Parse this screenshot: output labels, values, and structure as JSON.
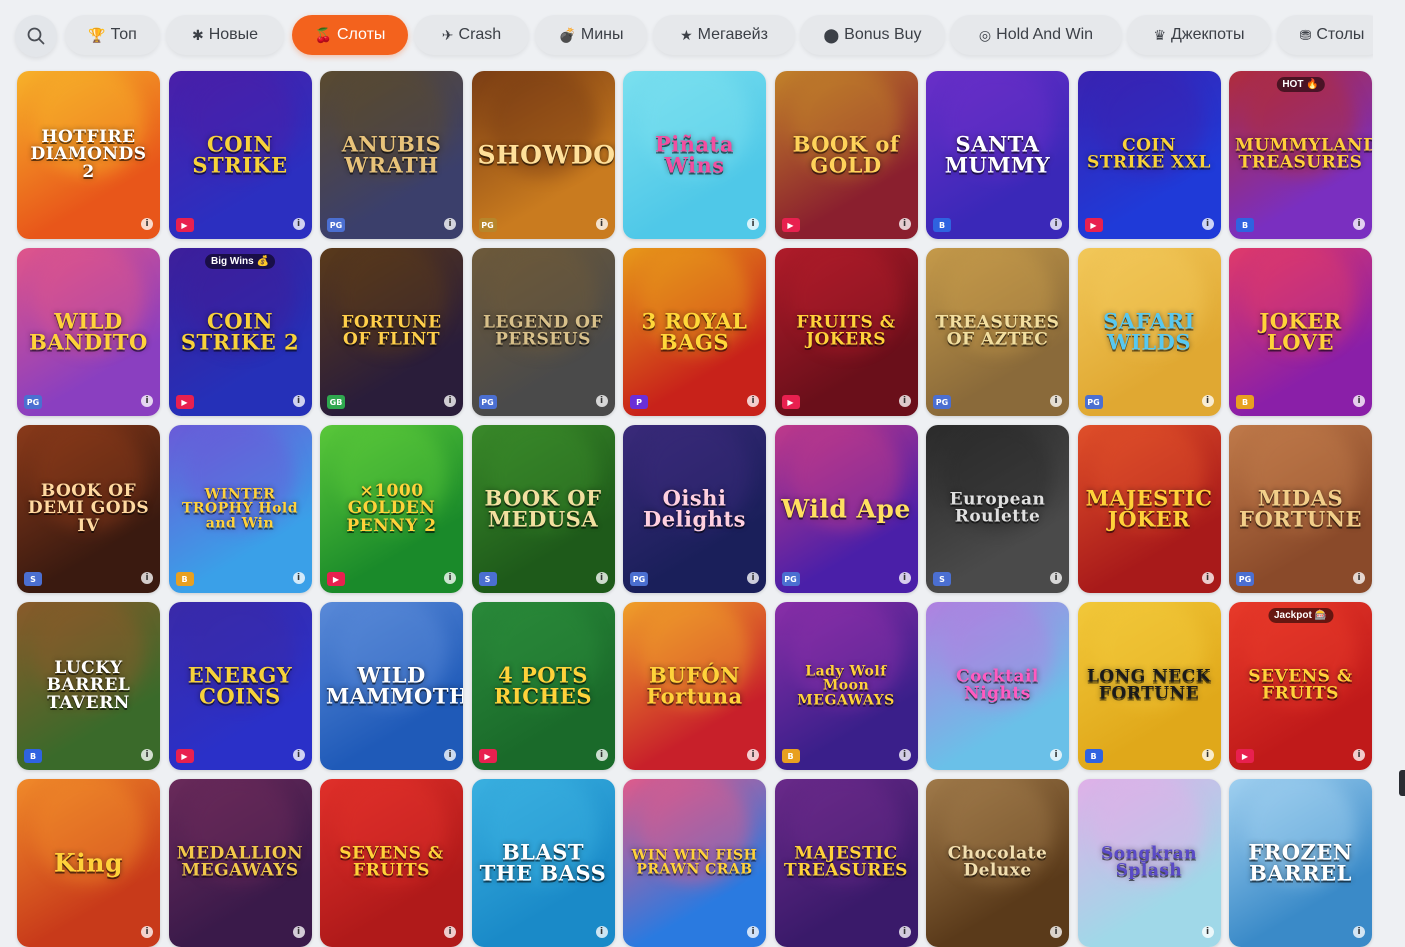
{
  "categories": [
    {
      "label": "Топ",
      "icon": "🏆",
      "active": false
    },
    {
      "label": "Новые",
      "icon": "✱",
      "active": false
    },
    {
      "label": "Слоты",
      "icon": "🍒",
      "active": true
    },
    {
      "label": "Crash",
      "icon": "✈",
      "active": false
    },
    {
      "label": "Мины",
      "icon": "💣",
      "active": false
    },
    {
      "label": "Мегавейз",
      "icon": "★",
      "active": false
    },
    {
      "label": "Bonus Buy",
      "icon": "⬤",
      "active": false
    },
    {
      "label": "Hold And Win",
      "icon": "◎",
      "active": false
    },
    {
      "label": "Джекпоты",
      "icon": "♛",
      "active": false
    },
    {
      "label": "Столы",
      "icon": "⛃",
      "active": false
    }
  ],
  "games": [
    {
      "title": "HOTFIRE DIAMONDS 2",
      "bg": "#e8561a",
      "bg2": "#f7b22a",
      "fg": "#ffffff",
      "prov": "",
      "provColor": "#e06a18",
      "badge": ""
    },
    {
      "title": "COIN STRIKE",
      "bg": "#2b2fc0",
      "bg2": "#4a1fa8",
      "fg": "#f7d23a",
      "prov": "▶",
      "provColor": "#e8204f",
      "badge": ""
    },
    {
      "title": "ANUBIS WRATH",
      "bg": "#3b3f6b",
      "bg2": "#5a4a2e",
      "fg": "#e8c37a",
      "prov": "PG",
      "provColor": "#4b6fd1",
      "badge": ""
    },
    {
      "title": "SHOWDOWN",
      "bg": "#c97b1f",
      "bg2": "#7a3d14",
      "fg": "#ffe09a",
      "prov": "PG",
      "provColor": "#b7862b",
      "badge": ""
    },
    {
      "title": "Piñata Wins",
      "bg": "#4fc8e8",
      "bg2": "#7be0ef",
      "fg": "#f24ea0",
      "prov": "",
      "provColor": "#4fc8e8",
      "badge": ""
    },
    {
      "title": "BOOK of GOLD",
      "bg": "#8a1f2e",
      "bg2": "#c2822a",
      "fg": "#ffd35a",
      "prov": "▶",
      "provColor": "#e8204f",
      "badge": ""
    },
    {
      "title": "SANTA MUMMY",
      "bg": "#3a28b8",
      "bg2": "#6a2fc8",
      "fg": "#ffffff",
      "prov": "B",
      "provColor": "#2f63e0",
      "badge": ""
    },
    {
      "title": "COIN STRIKE XXL",
      "bg": "#1f3ad8",
      "bg2": "#3a22b0",
      "fg": "#f7d23a",
      "prov": "▶",
      "provColor": "#e8204f",
      "badge": ""
    },
    {
      "title": "MUMMYLAND TREASURES",
      "bg": "#7a2fc0",
      "bg2": "#b02c3a",
      "fg": "#ffcf3a",
      "prov": "B",
      "provColor": "#2f63e0",
      "badge": "HOT 🔥"
    },
    {
      "title": "WILD BANDITO",
      "bg": "#8a3fc0",
      "bg2": "#e0558a",
      "fg": "#ffd23a",
      "prov": "PG",
      "provColor": "#4b6fd1",
      "badge": ""
    },
    {
      "title": "COIN STRIKE 2",
      "bg": "#2530b8",
      "bg2": "#3e1e9a",
      "fg": "#f7d23a",
      "prov": "▶",
      "provColor": "#e8204f",
      "badge": "Big Wins 💰"
    },
    {
      "title": "FORTUNE OF FLINT",
      "bg": "#2a1d3a",
      "bg2": "#5a3a1a",
      "fg": "#ffcf4a",
      "prov": "GB",
      "provColor": "#2fa84f",
      "badge": ""
    },
    {
      "title": "LEGEND OF PERSEUS",
      "bg": "#4a4a4a",
      "bg2": "#6e5a3a",
      "fg": "#d8c08a",
      "prov": "PG",
      "provColor": "#4b6fd1",
      "badge": ""
    },
    {
      "title": "3 ROYAL BAGS",
      "bg": "#c8221a",
      "bg2": "#e89a1a",
      "fg": "#ffd83a",
      "prov": "P",
      "provColor": "#6a2fd8",
      "badge": ""
    },
    {
      "title": "FRUITS & JOKERS",
      "bg": "#6a0f1a",
      "bg2": "#b01c2a",
      "fg": "#ffd23a",
      "prov": "▶",
      "provColor": "#e8204f",
      "badge": ""
    },
    {
      "title": "TREASURES OF AZTEC",
      "bg": "#8a6a3a",
      "bg2": "#c59a4a",
      "fg": "#f2dfa0",
      "prov": "PG",
      "provColor": "#4b6fd1",
      "badge": ""
    },
    {
      "title": "SAFARI WILDS",
      "bg": "#e0a832",
      "bg2": "#f2c85a",
      "fg": "#58c8f0",
      "prov": "PG",
      "provColor": "#4b6fd1",
      "badge": ""
    },
    {
      "title": "JOKER LOVE",
      "bg": "#8a1fa8",
      "bg2": "#e03a6a",
      "fg": "#ffd23a",
      "prov": "B",
      "provColor": "#e8a020",
      "badge": ""
    },
    {
      "title": "BOOK OF DEMI GODS IV",
      "bg": "#3a1a10",
      "bg2": "#8a3a1a",
      "fg": "#ffd9a0",
      "prov": "S",
      "provColor": "#4b6fd1",
      "badge": ""
    },
    {
      "title": "WINTER TROPHY Hold and Win",
      "bg": "#3aa0e8",
      "bg2": "#6a5ad8",
      "fg": "#ffd23a",
      "prov": "B",
      "provColor": "#e8a020",
      "badge": ""
    },
    {
      "title": "×1000 GOLDEN PENNY 2",
      "bg": "#1a8a2a",
      "bg2": "#5ac83a",
      "fg": "#ffd23a",
      "prov": "▶",
      "provColor": "#e8204f",
      "badge": ""
    },
    {
      "title": "BOOK OF MEDUSA",
      "bg": "#1e5a1a",
      "bg2": "#3a8a2a",
      "fg": "#f2e0a0",
      "prov": "S",
      "provColor": "#4b6fd1",
      "badge": ""
    },
    {
      "title": "Oishi Delights",
      "bg": "#1a1f5a",
      "bg2": "#3a2a7a",
      "fg": "#ffd0e0",
      "prov": "PG",
      "provColor": "#4b6fd1",
      "badge": ""
    },
    {
      "title": "Wild Ape",
      "bg": "#4a1fa8",
      "bg2": "#c03a8a",
      "fg": "#ffe060",
      "prov": "PG",
      "provColor": "#4b6fd1",
      "badge": ""
    },
    {
      "title": "European Roulette",
      "bg": "#4a4a4a",
      "bg2": "#2a2a2a",
      "fg": "#e0e0e0",
      "prov": "S",
      "provColor": "#4b6fd1",
      "badge": ""
    },
    {
      "title": "MAJESTIC JOKER",
      "bg": "#a81a1a",
      "bg2": "#e0502a",
      "fg": "#ffd23a",
      "prov": "",
      "provColor": "#e06a18",
      "badge": ""
    },
    {
      "title": "MIDAS FORTUNE",
      "bg": "#8a4a2a",
      "bg2": "#c07a4a",
      "fg": "#f2cf8a",
      "prov": "PG",
      "provColor": "#4b6fd1",
      "badge": ""
    },
    {
      "title": "LUCKY BARREL TAVERN",
      "bg": "#3a6a2a",
      "bg2": "#8a5a2a",
      "fg": "#ffffff",
      "prov": "B",
      "provColor": "#2f63e0",
      "badge": ""
    },
    {
      "title": "ENERGY COINS",
      "bg": "#2a30c8",
      "bg2": "#3a2aa8",
      "fg": "#f7d23a",
      "prov": "▶",
      "provColor": "#e8204f",
      "badge": ""
    },
    {
      "title": "WILD MAMMOTH",
      "bg": "#1f5ab8",
      "bg2": "#5a8ad8",
      "fg": "#ffffff",
      "prov": "",
      "provColor": "#e06a18",
      "badge": ""
    },
    {
      "title": "4 POTS RICHES",
      "bg": "#1a6a2a",
      "bg2": "#2a8a3a",
      "fg": "#ffd23a",
      "prov": "▶",
      "provColor": "#e8204f",
      "badge": ""
    },
    {
      "title": "BUFÓN Fortuna",
      "bg": "#c8202a",
      "bg2": "#f0a02a",
      "fg": "#ffd23a",
      "prov": "",
      "provColor": "#e8204f",
      "badge": ""
    },
    {
      "title": "Lady Wolf Moon MEGAWAYS",
      "bg": "#3a1f8a",
      "bg2": "#8a2fa8",
      "fg": "#ffd23a",
      "prov": "B",
      "provColor": "#e8a020",
      "badge": ""
    },
    {
      "title": "Cocktail Nights",
      "bg": "#6ac0e8",
      "bg2": "#b080e0",
      "fg": "#ff5ac0",
      "prov": "",
      "provColor": "#4fc8e8",
      "badge": ""
    },
    {
      "title": "LONG NECK FORTUNE",
      "bg": "#e0a81a",
      "bg2": "#f2c83a",
      "fg": "#1a1a1a",
      "prov": "B",
      "provColor": "#2f63e0",
      "badge": ""
    },
    {
      "title": "SEVENS & FRUITS",
      "bg": "#c01a1a",
      "bg2": "#e83a2a",
      "fg": "#ffd23a",
      "prov": "▶",
      "provColor": "#e8204f",
      "badge": "Jackpot 🎰"
    },
    {
      "title": "King",
      "bg": "#c83a1a",
      "bg2": "#f08a2a",
      "fg": "#ffd23a",
      "prov": "",
      "provColor": "#e06a18",
      "badge": ""
    },
    {
      "title": "MEDALLION MEGAWAYS",
      "bg": "#3a1a4a",
      "bg2": "#6a2a5a",
      "fg": "#f2c84a",
      "prov": "",
      "provColor": "#4b6fd1",
      "badge": ""
    },
    {
      "title": "SEVENS & FRUITS",
      "bg": "#b01a1a",
      "bg2": "#e0302a",
      "fg": "#ffd23a",
      "prov": "",
      "provColor": "#e8204f",
      "badge": ""
    },
    {
      "title": "BLAST THE BASS",
      "bg": "#1a8ac8",
      "bg2": "#3ab0e0",
      "fg": "#ffffff",
      "prov": "",
      "provColor": "#4b6fd1",
      "badge": ""
    },
    {
      "title": "WIN WIN FISH PRAWN CRAB",
      "bg": "#2a7ae0",
      "bg2": "#e05a8a",
      "fg": "#ffd23a",
      "prov": "",
      "provColor": "#4b6fd1",
      "badge": ""
    },
    {
      "title": "MAJESTIC TREASURES",
      "bg": "#3a1a6a",
      "bg2": "#6a2a8a",
      "fg": "#ffd23a",
      "prov": "",
      "provColor": "#4b6fd1",
      "badge": ""
    },
    {
      "title": "Chocolate Deluxe",
      "bg": "#5a3a1a",
      "bg2": "#a07a4a",
      "fg": "#f2dfb0",
      "prov": "",
      "provColor": "#4b6fd1",
      "badge": ""
    },
    {
      "title": "Songkran Splash",
      "bg": "#a0d8e8",
      "bg2": "#e0b0e8",
      "fg": "#5a4ac8",
      "prov": "",
      "provColor": "#4b6fd1",
      "badge": ""
    },
    {
      "title": "FROZEN BARREL",
      "bg": "#3a8ac8",
      "bg2": "#a0d0f0",
      "fg": "#ffffff",
      "prov": "",
      "provColor": "#4b6fd1",
      "badge": ""
    }
  ]
}
